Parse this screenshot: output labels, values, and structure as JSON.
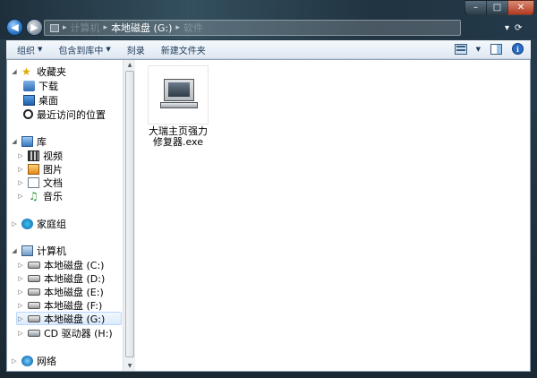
{
  "address_bar": {
    "crumbs": [
      "计算机",
      "本地磁盘 (G:)",
      "软件"
    ]
  },
  "window_controls": {
    "minimize": "–",
    "maximize": "□",
    "close": "✕"
  },
  "toolbar": {
    "organize": "组织",
    "include_in_library": "包含到库中",
    "burn": "刻录",
    "new_folder": "新建文件夹"
  },
  "nav": {
    "favorites": {
      "label": "收藏夹",
      "items": [
        {
          "label": "下载",
          "icon": "download-icon"
        },
        {
          "label": "桌面",
          "icon": "desktop-icon"
        },
        {
          "label": "最近访问的位置",
          "icon": "recent-places-icon"
        }
      ]
    },
    "libraries": {
      "label": "库",
      "items": [
        {
          "label": "视频",
          "icon": "video-icon"
        },
        {
          "label": "图片",
          "icon": "pictures-icon"
        },
        {
          "label": "文档",
          "icon": "documents-icon"
        },
        {
          "label": "音乐",
          "icon": "music-icon"
        }
      ]
    },
    "homegroup": {
      "label": "家庭组"
    },
    "computer": {
      "label": "计算机",
      "items": [
        {
          "label": "本地磁盘 (C:)"
        },
        {
          "label": "本地磁盘 (D:)"
        },
        {
          "label": "本地磁盘 (E:)"
        },
        {
          "label": "本地磁盘 (F:)"
        },
        {
          "label": "本地磁盘 (G:)",
          "selected": true
        },
        {
          "label": "CD 驱动器 (H:)"
        }
      ]
    },
    "network": {
      "label": "网络"
    }
  },
  "files": [
    {
      "name": "大瑞主页强力修复器.exe",
      "icon": "computer-program-icon"
    }
  ]
}
